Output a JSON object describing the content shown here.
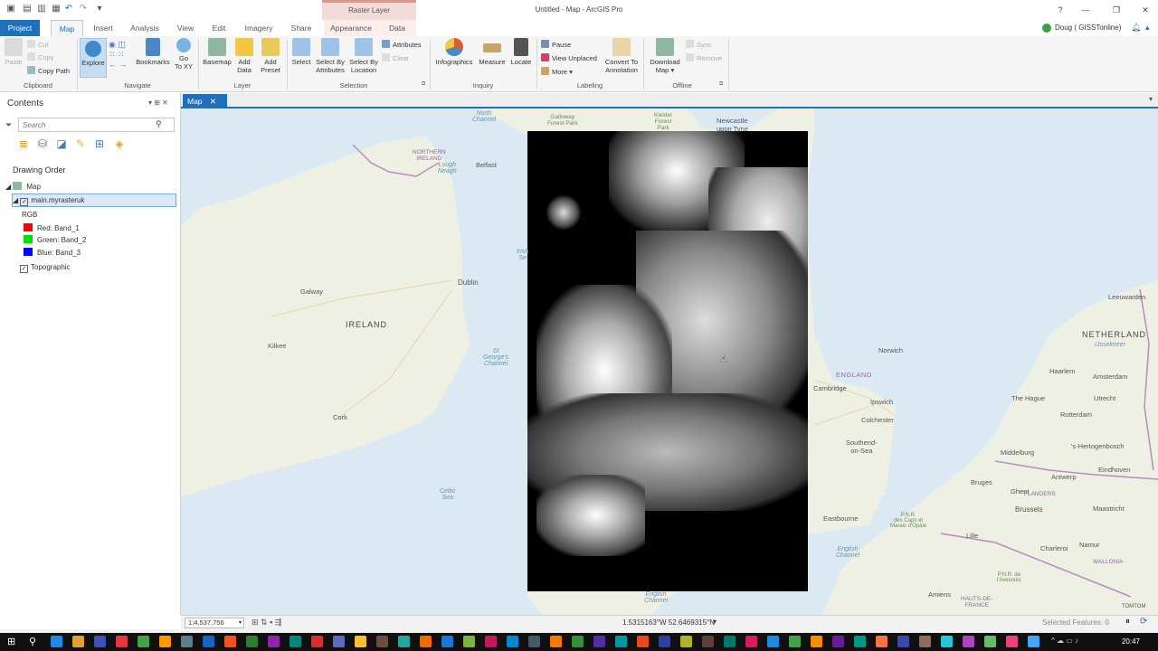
{
  "window": {
    "title": "Untitled - Map - ArcGIS Pro",
    "contextual_group": "Raster Layer",
    "user": "Doug ( GISSTonline)",
    "help": "?"
  },
  "tabs": [
    "Project",
    "Map",
    "Insert",
    "Analysis",
    "View",
    "Edit",
    "Imagery",
    "Share",
    "Appearance",
    "Data"
  ],
  "ribbon": {
    "clipboard": {
      "label": "Clipboard",
      "paste": "Paste",
      "cut": "Cut",
      "copy": "Copy",
      "copy_path": "Copy Path"
    },
    "navigate": {
      "label": "Navigate",
      "explore": "Explore",
      "bookmarks": "Bookmarks",
      "goto_xy_1": "Go",
      "goto_xy_2": "To XY"
    },
    "layer": {
      "label": "Layer",
      "basemap": "Basemap",
      "add_data_1": "Add",
      "add_data_2": "Data",
      "add_preset_1": "Add",
      "add_preset_2": "Preset"
    },
    "selection": {
      "label": "Selection",
      "select": "Select",
      "by_attr_1": "Select By",
      "by_attr_2": "Attributes",
      "by_loc_1": "Select By",
      "by_loc_2": "Location",
      "attributes": "Attributes",
      "clear": "Clear"
    },
    "inquiry": {
      "label": "Inquiry",
      "infographics": "Infographics",
      "measure": "Measure",
      "locate": "Locate"
    },
    "labeling": {
      "label": "Labeling",
      "pause": "Pause",
      "view_unplaced": "View Unplaced",
      "more": "More",
      "convert_1": "Convert To",
      "convert_2": "Annotation"
    },
    "offline": {
      "label": "Offline",
      "download_1": "Download",
      "download_2": "Map",
      "sync": "Sync",
      "remove": "Remove"
    }
  },
  "contents": {
    "title": "Contents",
    "search_placeholder": "Search",
    "drawing_order": "Drawing Order",
    "map": "Map",
    "layer": "main.myrasteruk",
    "rgb": "RGB",
    "red": "Red:  Band_1",
    "green": "Green:  Band_2",
    "blue": "Blue:  Band_3",
    "topographic": "Topographic",
    "colors": {
      "red": "#ff0000",
      "green": "#00e000",
      "blue": "#0000ff"
    }
  },
  "map_view": {
    "tab": "Map",
    "labels": {
      "north_channel": "North\nChannel",
      "galloway": "Galloway\nForest Park",
      "kielder": "Kielder\nForest\nPark",
      "newcastle": "Newcastle\nupon Tyne",
      "northern_ireland": "NORTHERN\nIRELAND",
      "lough_neagh": "Lough\nNeagh",
      "belfast": "Belfast",
      "irish_sea": "Irish\nSe",
      "dublin": "Dublin",
      "galway": "Galway",
      "ireland": "IRELAND",
      "kilkee": "Kilkee",
      "st_georges": "St\nGeorge's\nChannel",
      "cork": "Cork",
      "celtic_sea": "Celtic\nSea",
      "english_channel_bottom": "English\nChannel",
      "norwich": "Norwich",
      "england": "ENGLAND",
      "cambridge": "Cambridge",
      "ipswich": "Ipswich",
      "colchester": "Colchester",
      "southend": "Southend-\non-Sea",
      "eastbourne": "Eastbourne",
      "english_channel": "English\nChannel",
      "netherlands": "NETHERLAND",
      "leeuwarden": "Leeuwarden",
      "ijsselmeer": "IJsselmeer",
      "haarlem": "Haarlem",
      "amsterdam": "Amsterdam",
      "the_hague": "The Hague",
      "utrecht": "Utrecht",
      "rotterdam": "Rotterdam",
      "middelburg": "Middelburg",
      "hertogenbosch": "'s-Hertogenbosch",
      "eindhoven": "Eindhoven",
      "bruges": "Bruges",
      "ghent": "Ghent",
      "antwerp": "Antwerp",
      "flanders": "FLANDERS",
      "brussels": "Brussels",
      "maastricht": "Maastricht",
      "pnr": "P.N.R.\ndes Caps et\nMarais d'Opale",
      "lille": "Lille",
      "namur": "Namur",
      "charleroi": "Charleroi",
      "wallonia": "WALLONIA",
      "pnr_avesnois": "P.N.R. de\nl'Avesnois",
      "amiens": "Amiens",
      "hauts": "HAUTS-DE-\nFRANCE",
      "thomtom": "TOMTOM"
    }
  },
  "status": {
    "scale": "1:4,537,756",
    "coords": "1.5315163°W 52.6469315°N",
    "selected_features": "Selected Features: 0"
  },
  "taskbar": {
    "clock": "20:47"
  }
}
